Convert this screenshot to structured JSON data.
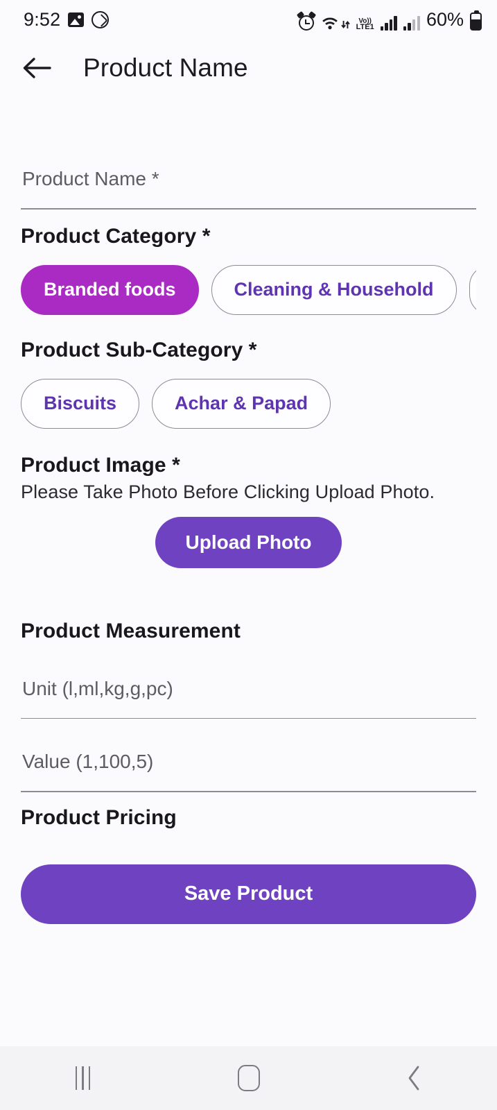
{
  "status_bar": {
    "time": "9:52",
    "left_icons": [
      "photo-icon",
      "call-recorder-icon"
    ],
    "right_icons": [
      "alarm-icon",
      "wifi-icon",
      "volte-icon",
      "signal-icon",
      "signal-secondary-icon"
    ],
    "network_label_top": "Vo))",
    "network_label_bottom": "LTE1",
    "battery_text": "60%"
  },
  "app_bar": {
    "back_icon": "arrow-left-icon",
    "title": "Product Name"
  },
  "form": {
    "product_name": {
      "placeholder": "Product Name *",
      "value": ""
    },
    "category": {
      "heading": "Product Category *",
      "chips": [
        {
          "label": "Branded foods",
          "selected": true
        },
        {
          "label": "Cleaning & Household",
          "selected": false
        }
      ]
    },
    "sub_category": {
      "heading": "Product Sub-Category *",
      "chips": [
        {
          "label": "Biscuits",
          "selected": false
        },
        {
          "label": "Achar & Papad",
          "selected": false
        }
      ]
    },
    "image": {
      "heading": "Product Image *",
      "note": "Please Take Photo Before Clicking Upload Photo.",
      "upload_label": "Upload Photo"
    },
    "measurement": {
      "heading": "Product Measurement",
      "unit": {
        "placeholder": "Unit (l,ml,kg,g,pc)",
        "value": ""
      },
      "value": {
        "placeholder": "Value (1,100,5)",
        "value": ""
      }
    },
    "pricing": {
      "heading": "Product Pricing"
    },
    "save_label": "Save Product"
  },
  "nav_bar": {
    "recents": "recents-icon",
    "home": "home-icon",
    "back": "back-icon"
  },
  "colors": {
    "accent_purple": "#6f42c1",
    "selected_chip": "#aa2bc3",
    "chip_text": "#5f34b0",
    "background": "#fbfafd"
  }
}
